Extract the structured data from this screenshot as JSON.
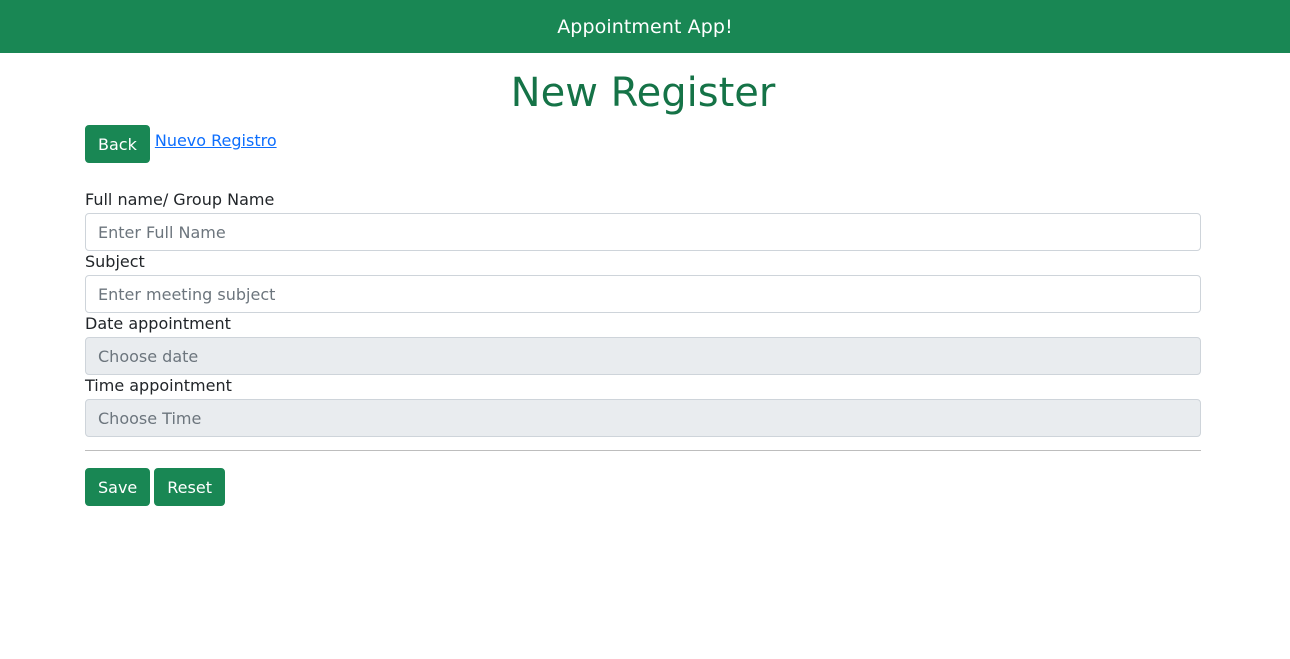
{
  "navbar": {
    "title": "Appointment App!"
  },
  "page": {
    "title": "New Register"
  },
  "actions": {
    "back_label": "Back",
    "link_label": "Nuevo Registro"
  },
  "form": {
    "fields": [
      {
        "label": "Full name/ Group Name",
        "placeholder": "Enter Full Name",
        "value": ""
      },
      {
        "label": "Subject",
        "placeholder": "Enter meeting subject",
        "value": ""
      },
      {
        "label": "Date appointment",
        "placeholder": "Choose date",
        "value": ""
      },
      {
        "label": "Time appointment",
        "placeholder": "Choose Time",
        "value": ""
      }
    ],
    "save_label": "Save",
    "reset_label": "Reset"
  },
  "colors": {
    "primary": "#198754",
    "title": "#157347",
    "link": "#0d6efd",
    "readonly_bg": "#e9ecef"
  }
}
